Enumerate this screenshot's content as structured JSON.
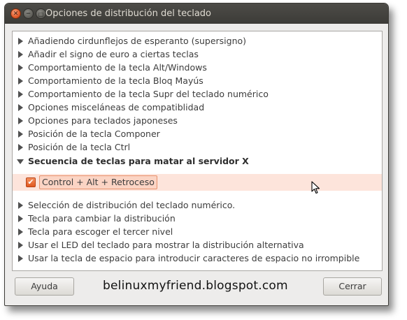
{
  "window": {
    "title": "Opciones de distribución del teclado"
  },
  "tree": {
    "items_before": [
      "Añadiendo cirdunflejos de esperanto (supersigno)",
      "Añadir el signo de euro a ciertas teclas",
      "Comportamiento de la tecla Alt/Windows",
      "Comportamiento de la tecla Bloq Mayús",
      "Comportamiento de la tecla Supr del teclado numérico",
      "Opciones misceláneas de compatiblidad",
      "Opciones para teclados japoneses",
      "Posición de la tecla Componer",
      "Posición de la tecla Ctrl"
    ],
    "expanded": {
      "label": "Secuencia de teclas para matar al servidor X",
      "option": {
        "label": "Control + Alt + Retroceso",
        "checked": true
      }
    },
    "items_after": [
      "Selección de distribución del teclado numérico.",
      "Tecla para cambiar la distribución",
      "Tecla para escoger el tercer nivel",
      "Usar el LED del teclado para mostrar la distribución alternativa",
      "Usar la tecla de espacio para introducir caracteres de espacio no irrompible"
    ]
  },
  "buttons": {
    "help": "Ayuda",
    "close": "Cerrar"
  },
  "watermark": "belinuxmyfriend.blogspot.com",
  "colors": {
    "accent": "#e0581f",
    "selection_bg": "#fde4db",
    "titlebar": "#3c3b37"
  }
}
